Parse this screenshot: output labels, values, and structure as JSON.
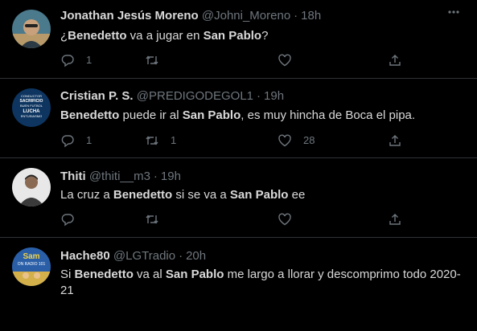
{
  "tweets": [
    {
      "name": "Jonathan Jesús Moreno",
      "handle": "@Johni_Moreno",
      "dot": "·",
      "time": "18h",
      "text": [
        {
          "t": "¿",
          "b": false
        },
        {
          "t": "Benedetto",
          "b": true
        },
        {
          "t": " va a jugar en ",
          "b": false
        },
        {
          "t": "San Pablo",
          "b": true
        },
        {
          "t": "?",
          "b": false
        }
      ],
      "reply_count": "1",
      "retweet_count": "",
      "like_count": ""
    },
    {
      "name": "Cristian P. S.",
      "handle": "@PREDIGODEGOL1",
      "dot": "·",
      "time": "19h",
      "text": [
        {
          "t": "Benedetto",
          "b": true
        },
        {
          "t": " puede ir al ",
          "b": false
        },
        {
          "t": "San Pablo",
          "b": true
        },
        {
          "t": ", es muy hincha de Boca el pipa.",
          "b": false
        }
      ],
      "reply_count": "1",
      "retweet_count": "1",
      "like_count": "28"
    },
    {
      "name": "Thiti",
      "handle": "@thiti__m3",
      "dot": "·",
      "time": "19h",
      "text": [
        {
          "t": "La cruz a ",
          "b": false
        },
        {
          "t": "Benedetto",
          "b": true
        },
        {
          "t": " si se va a ",
          "b": false
        },
        {
          "t": "San Pablo",
          "b": true
        },
        {
          "t": " ee",
          "b": false
        }
      ],
      "reply_count": "",
      "retweet_count": "",
      "like_count": ""
    },
    {
      "name": "Hache80",
      "handle": "@LGTradio",
      "dot": "·",
      "time": "20h",
      "text": [
        {
          "t": "Si ",
          "b": false
        },
        {
          "t": "Benedetto",
          "b": true
        },
        {
          "t": " va al ",
          "b": false
        },
        {
          "t": "San Pablo",
          "b": true
        },
        {
          "t": " me largo a llorar y descomprimo todo 2020-21",
          "b": false
        }
      ],
      "reply_count": "",
      "retweet_count": "",
      "like_count": ""
    }
  ],
  "avatar_texts": {
    "cristian": [
      "CONDUCTOR",
      "SACRIFICIO",
      "BUEN FUTBOL",
      "LUCHA",
      "ENTUSIASMO"
    ],
    "hache": [
      "Sam",
      "ON RADIO 101"
    ]
  },
  "colors": {
    "background": "#000000",
    "text": "#d9d9d9",
    "muted": "#6e767d",
    "divider": "#2f3336"
  },
  "icons": [
    "more-icon",
    "reply-icon",
    "retweet-icon",
    "like-icon",
    "share-icon"
  ]
}
